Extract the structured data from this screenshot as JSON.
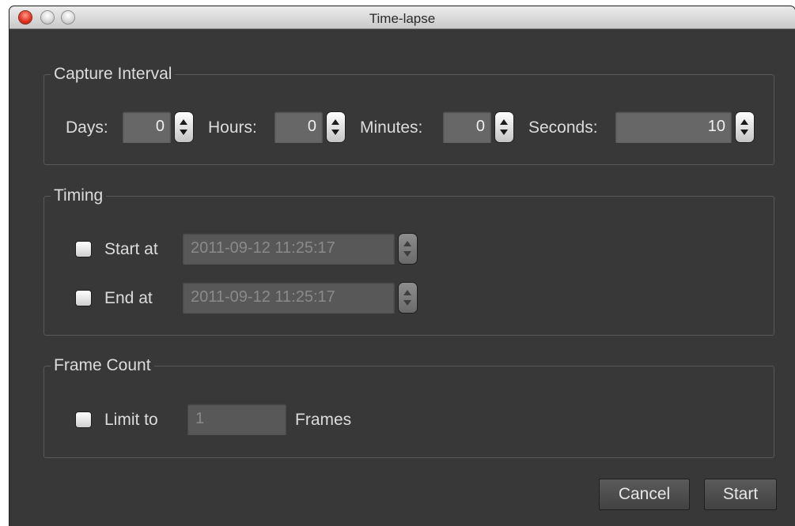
{
  "window": {
    "title": "Time-lapse"
  },
  "capture_interval": {
    "legend": "Capture Interval",
    "days": {
      "label": "Days:",
      "value": "0"
    },
    "hours": {
      "label": "Hours:",
      "value": "0"
    },
    "minutes": {
      "label": "Minutes:",
      "value": "0"
    },
    "seconds": {
      "label": "Seconds:",
      "value": "10"
    }
  },
  "timing": {
    "legend": "Timing",
    "start": {
      "label": "Start at",
      "value": "2011-09-12 11:25:17",
      "checked": false
    },
    "end": {
      "label": "End at",
      "value": "2011-09-12 11:25:17",
      "checked": false
    }
  },
  "frame_count": {
    "legend": "Frame Count",
    "limit_label": "Limit to",
    "value": "1",
    "suffix": "Frames",
    "checked": false
  },
  "buttons": {
    "cancel": "Cancel",
    "start": "Start"
  },
  "colors": {
    "window_bg": "#383838",
    "close_button": "#e0301e"
  }
}
